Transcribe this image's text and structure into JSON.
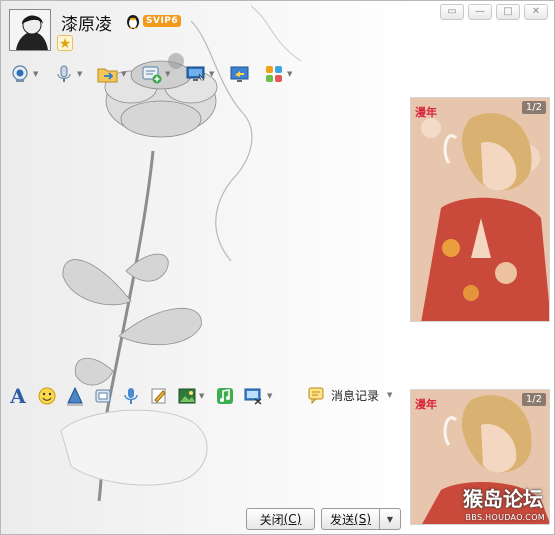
{
  "window": {
    "controls": {
      "restore": "▭",
      "minimize": "—",
      "maximize": "□",
      "close": "✕"
    }
  },
  "contact": {
    "name": "漆原凌",
    "vip_label": "SVIP6",
    "avatar_icon": "user-avatar",
    "star_icon": "★"
  },
  "toolbar_top": [
    {
      "name": "video-call",
      "icon": "webcam-icon",
      "has_dropdown": true
    },
    {
      "name": "voice-call",
      "icon": "microphone-icon",
      "has_dropdown": true
    },
    {
      "name": "send-file",
      "icon": "folder-transfer-icon",
      "has_dropdown": true
    },
    {
      "name": "create-discussion",
      "icon": "group-add-icon",
      "has_dropdown": true
    },
    {
      "name": "remote-assist",
      "icon": "monitor-icon",
      "has_dropdown": true
    },
    {
      "name": "share-screen",
      "icon": "screen-share-icon",
      "has_dropdown": false
    },
    {
      "name": "apps",
      "icon": "apps-grid-icon",
      "has_dropdown": true
    }
  ],
  "toolbar_mid": [
    {
      "name": "font",
      "icon": "font-icon",
      "glyph": "A"
    },
    {
      "name": "emoji",
      "icon": "smiley-icon"
    },
    {
      "name": "shake",
      "icon": "shake-icon"
    },
    {
      "name": "voice-message",
      "icon": "phone-icon"
    },
    {
      "name": "voice-input",
      "icon": "mic-icon"
    },
    {
      "name": "handwriting",
      "icon": "pen-icon"
    },
    {
      "name": "image",
      "icon": "picture-icon"
    },
    {
      "name": "music",
      "icon": "music-icon"
    },
    {
      "name": "screenshot",
      "icon": "scissors-screen-icon"
    }
  ],
  "history": {
    "label": "消息记录",
    "icon": "message-history-icon"
  },
  "ads": {
    "counter_top": "1/2",
    "counter_bottom": "1/2",
    "logo_top": "漫年",
    "logo_bottom": "漫年",
    "watermark_text": "猴岛论坛",
    "watermark_url": "BBS.HOUDAO.COM"
  },
  "buttons": {
    "close": {
      "label": "关闭",
      "shortcut": "(C)"
    },
    "send": {
      "label": "发送",
      "shortcut": "(S)"
    },
    "send_dropdown_glyph": "▼"
  },
  "colors": {
    "accent_vip": "#f19a1b",
    "ad_logo": "#d8263c"
  }
}
